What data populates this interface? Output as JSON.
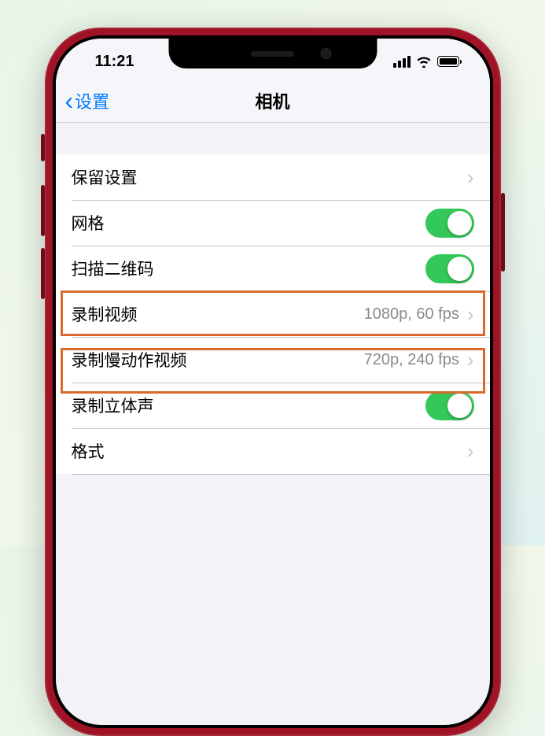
{
  "status": {
    "time": "11:21"
  },
  "nav": {
    "back_label": "设置",
    "title": "相机"
  },
  "rows": {
    "preserve": {
      "label": "保留设置"
    },
    "grid": {
      "label": "网格",
      "toggle_on": true
    },
    "qr": {
      "label": "扫描二维码",
      "toggle_on": true
    },
    "record_video": {
      "label": "录制视频",
      "value": "1080p, 60 fps"
    },
    "record_slomo": {
      "label": "录制慢动作视频",
      "value": "720p, 240 fps"
    },
    "stereo": {
      "label": "录制立体声",
      "toggle_on": true
    },
    "format": {
      "label": "格式"
    }
  },
  "colors": {
    "accent": "#007aff",
    "toggle_on": "#34c759",
    "highlight": "#d96a2b",
    "phone_frame": "#a01225"
  }
}
